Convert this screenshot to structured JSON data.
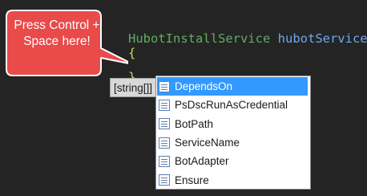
{
  "editor": {
    "code": {
      "type_name": "HubotInstallService",
      "variable_name": "hubotService",
      "open_brace": "{",
      "close_brace": "}"
    }
  },
  "callout": {
    "text": "Press Control + Space here!",
    "fill_color": "#e94a4a",
    "border_color": "#ffffff"
  },
  "type_hint": "[string[]]",
  "completion": {
    "selected_index": 0,
    "items": [
      {
        "label": "DependsOn",
        "icon": "property-icon"
      },
      {
        "label": "PsDscRunAsCredential",
        "icon": "property-icon"
      },
      {
        "label": "BotPath",
        "icon": "property-icon"
      },
      {
        "label": "ServiceName",
        "icon": "property-icon"
      },
      {
        "label": "BotAdapter",
        "icon": "property-icon"
      },
      {
        "label": "Ensure",
        "icon": "property-icon"
      }
    ]
  },
  "colors": {
    "background": "#242424",
    "selection": "#3399ff",
    "type_keyword": "#5fae5f",
    "variable": "#6fa8f0",
    "brace": "#d4d44e"
  }
}
